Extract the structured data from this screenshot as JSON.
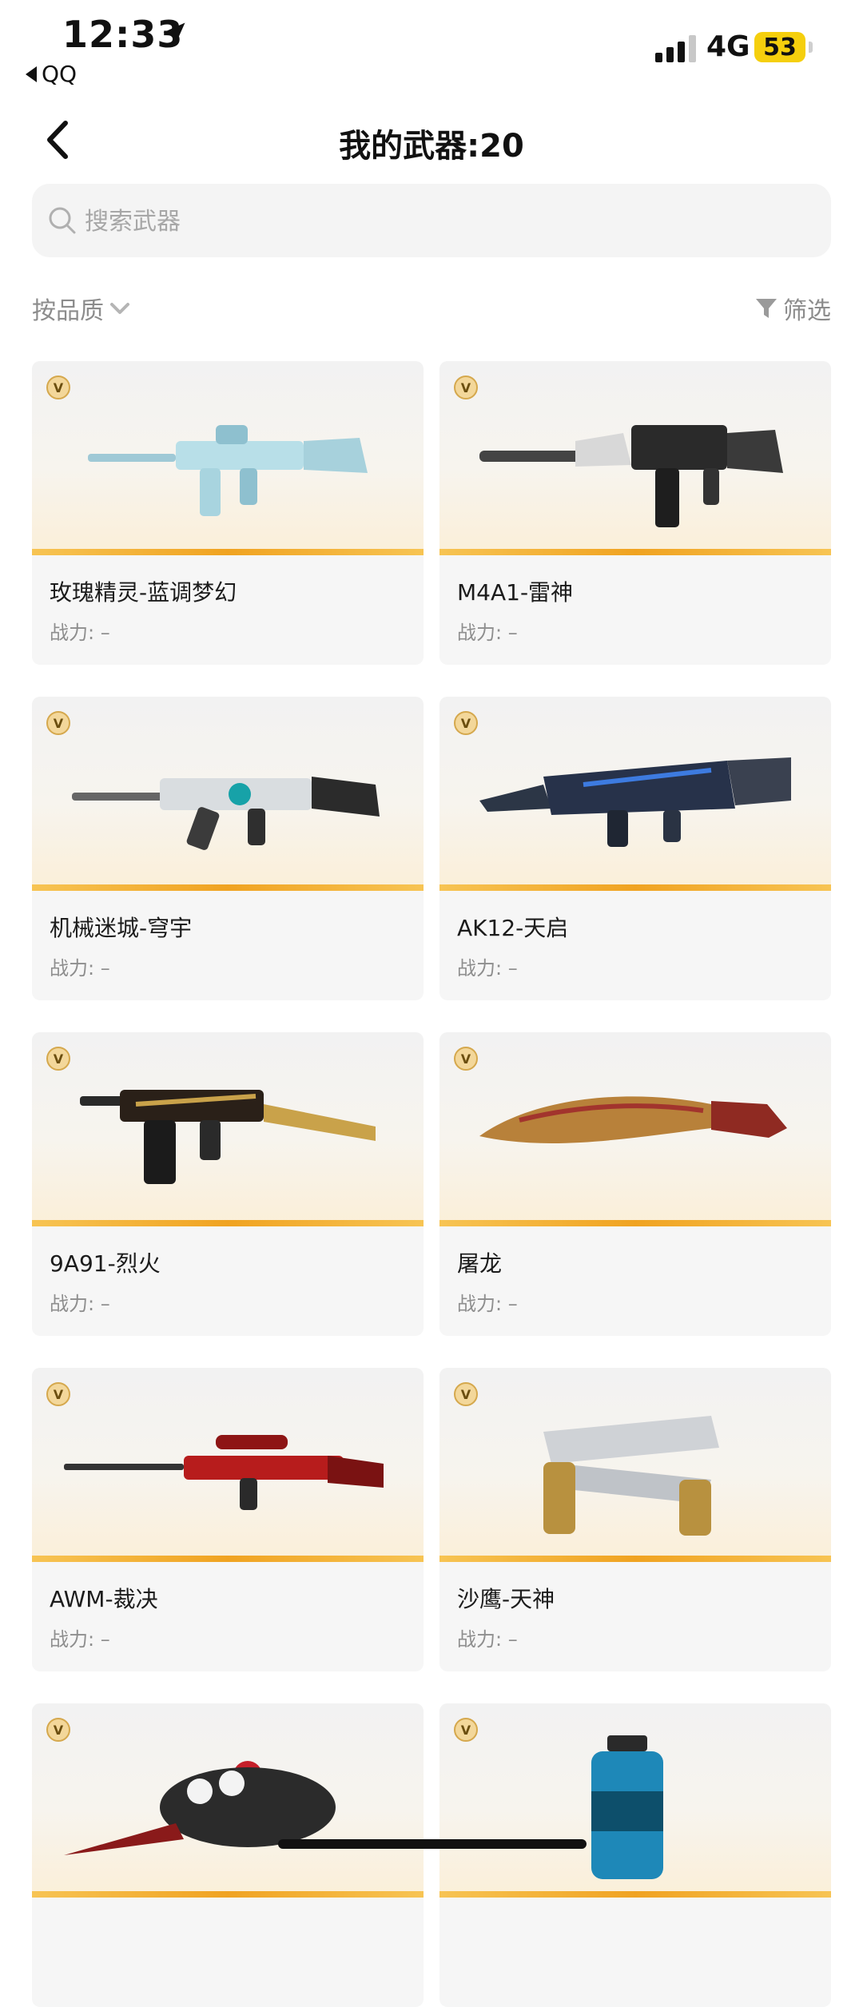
{
  "status_bar": {
    "time": "12:33",
    "back_app": "QQ",
    "network": "4G",
    "battery": "53"
  },
  "header": {
    "title": "我的武器:20"
  },
  "search": {
    "placeholder": "搜索武器"
  },
  "controls": {
    "sort_label": "按品质",
    "filter_label": "筛选"
  },
  "badge_label": "V",
  "weapons": [
    {
      "name": "玫瑰精灵-蓝调梦幻",
      "power": "战力: –",
      "art": "rifle-blue"
    },
    {
      "name": "M4A1-雷神",
      "power": "战力: –",
      "art": "rifle-black"
    },
    {
      "name": "机械迷城-穹宇",
      "power": "战力: –",
      "art": "rifle-teal"
    },
    {
      "name": "AK12-天启",
      "power": "战力: –",
      "art": "rifle-dark"
    },
    {
      "name": "9A91-烈火",
      "power": "战力: –",
      "art": "smg-gold"
    },
    {
      "name": "屠龙",
      "power": "战力: –",
      "art": "knife-gold"
    },
    {
      "name": "AWM-裁决",
      "power": "战力: –",
      "art": "sniper-red"
    },
    {
      "name": "沙鹰-天神",
      "power": "战力: –",
      "art": "pistols-gold"
    },
    {
      "name": "",
      "power": "",
      "art": "knuckle-knife"
    },
    {
      "name": "",
      "power": "",
      "art": "grenade-blue"
    }
  ]
}
